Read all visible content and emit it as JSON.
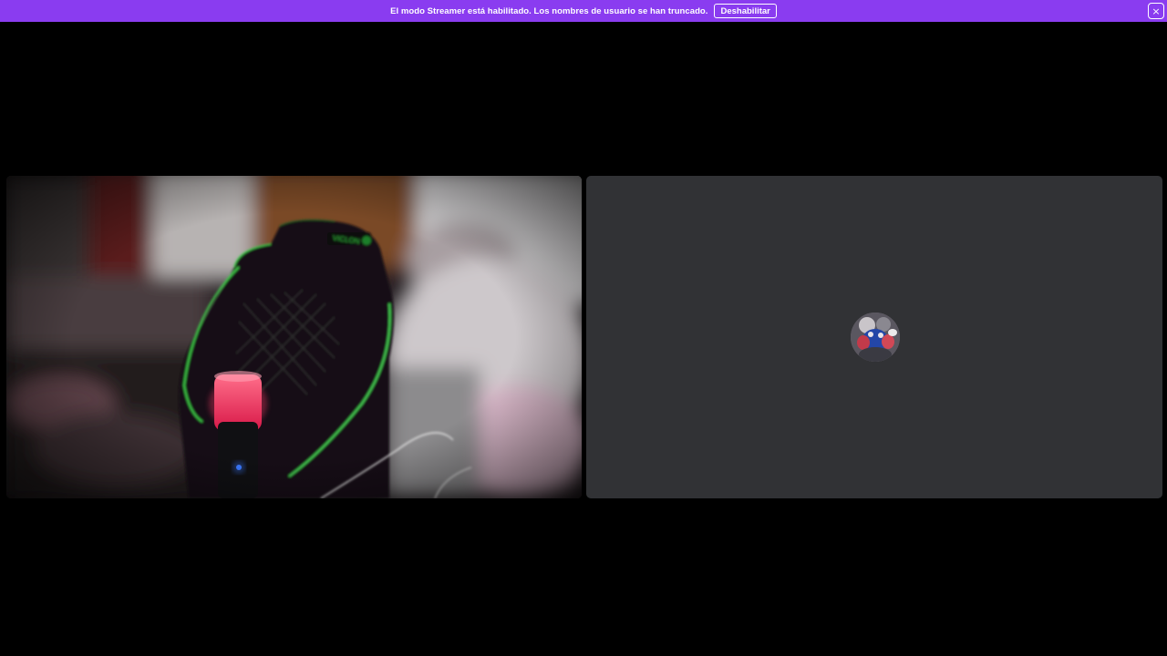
{
  "notice": {
    "message": "El modo Streamer está habilitado. Los nombres de usuario se han truncado.",
    "disable_label": "Deshabilitar",
    "close_glyph": "×",
    "background_color": "#8a3cf0"
  },
  "call": {
    "participants": [
      {
        "type": "camera-video"
      },
      {
        "type": "avatar-only"
      }
    ]
  }
}
